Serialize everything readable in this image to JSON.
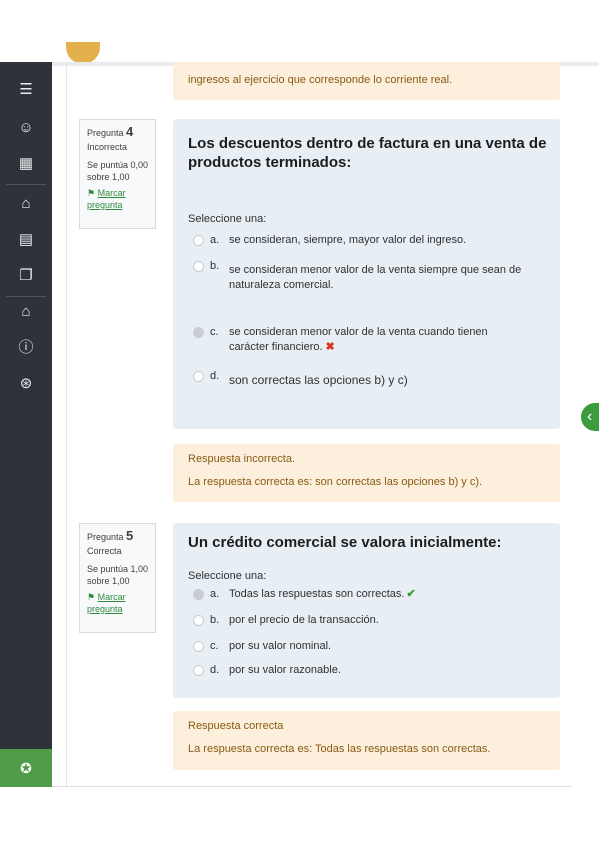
{
  "sidebar": {
    "icons": [
      "list-icon",
      "participants-icon",
      "grades-icon",
      "home-icon",
      "calendar-icon",
      "files-icon",
      "courses-icon",
      "info-icon",
      "support-icon"
    ],
    "accessibility_icon": "accessibility-icon"
  },
  "prev_feedback": {
    "text": "ingresos al ejercicio que corresponde lo corriente real."
  },
  "q4": {
    "label": "Pregunta",
    "number": "4",
    "state": "Incorrecta",
    "grade": "Se puntúa 0,00 sobre 1,00",
    "flag_label": "Marcar pregunta",
    "title": "Los descuentos dentro de factura en una venta de productos terminados:",
    "prompt": "Seleccione una:",
    "options": [
      {
        "letter": "a.",
        "text": "se consideran, siempre, mayor valor del ingreso."
      },
      {
        "letter": "b.",
        "text": "se consideran menor valor de la venta siempre que sean de naturaleza comercial."
      },
      {
        "letter": "c.",
        "text": "se consideran menor valor de la venta cuando tienen carácter financiero.",
        "mark": "✖"
      },
      {
        "letter": "d.",
        "text": "son correctas las opciones b) y c)"
      }
    ],
    "feedback_status": "Respuesta incorrecta.",
    "feedback_answer": "La respuesta correcta es: son correctas las opciones b) y c)."
  },
  "q5": {
    "label": "Pregunta",
    "number": "5",
    "state": "Correcta",
    "grade": "Se puntúa 1,00 sobre 1,00",
    "flag_label": "Marcar pregunta",
    "title": "Un crédito comercial se valora inicialmente:",
    "prompt": "Seleccione una:",
    "options": [
      {
        "letter": "a.",
        "text": "Todas las respuestas son correctas.",
        "mark": "✔"
      },
      {
        "letter": "b.",
        "text": "por el precio de la transacción."
      },
      {
        "letter": "c.",
        "text": "por su valor nominal."
      },
      {
        "letter": "d.",
        "text": "por su valor razonable."
      }
    ],
    "feedback_status": "Respuesta correcta",
    "feedback_answer": "La respuesta correcta es: Todas las respuestas son correctas."
  },
  "drawer_toggle_icon": "chevron-left-icon"
}
